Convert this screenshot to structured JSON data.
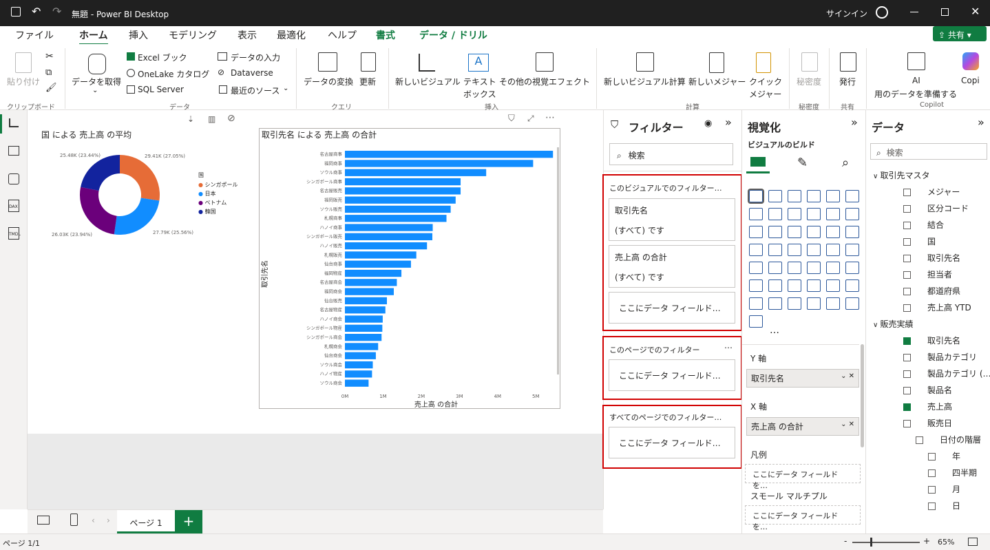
{
  "window": {
    "title": "無題 - Power BI Desktop",
    "signin": "サインイン"
  },
  "tabs": [
    "ファイル",
    "ホーム",
    "挿入",
    "モデリング",
    "表示",
    "最適化",
    "ヘルプ",
    "書式",
    "データ / ドリル"
  ],
  "share": "共有",
  "ribbon": {
    "clipboard": {
      "paste": "貼り付け",
      "group": "クリップボード"
    },
    "data": {
      "get": "データを取得",
      "excel": "Excel ブック",
      "onelake": "OneLake カタログ",
      "sql": "SQL Server",
      "enter": "データの入力",
      "dataverse": "Dataverse",
      "recent": "最近のソース",
      "group": "データ"
    },
    "query": {
      "transform": "データの変換",
      "refresh": "更新",
      "group": "クエリ"
    },
    "insert": {
      "newvisual": "新しいビジュアル",
      "textbox1": "テキスト",
      "textbox2": "ボックス",
      "more": "その他の視覚エフェクト",
      "group": "挿入"
    },
    "calc": {
      "newcalc": "新しいビジュアル計算",
      "newmeasure": "新しいメジャー",
      "quick1": "クイック",
      "quick2": "メジャー",
      "group": "計算"
    },
    "sens": {
      "label": "秘密度",
      "group": "秘密度"
    },
    "share": {
      "publish": "発行",
      "group": "共有"
    },
    "copilot": {
      "ai1": "AI",
      "ai2": "用のデータを準備する",
      "copi": "Copi",
      "group": "Copilot"
    }
  },
  "donut": {
    "title": "国 による 売上高 の平均",
    "legend_title": "国",
    "legend": [
      "シンガポール",
      "日本",
      "ベトナム",
      "韓国"
    ],
    "labels": [
      "29.41K (27.05%)",
      "27.79K (25.56%)",
      "26.03K (23.94%)",
      "25.48K (23.44%)"
    ]
  },
  "bar_title": "取引先名 による 売上高 の合計",
  "chart_data": {
    "type": "bar",
    "title": "取引先名 による 売上高 の合計",
    "xlabel": "売上高 の合計",
    "ylabel": "取引先名",
    "xlim": [
      0,
      5.5
    ],
    "xticks": [
      "0M",
      "1M",
      "2M",
      "3M",
      "4M",
      "5M"
    ],
    "categories": [
      "名古屋商事",
      "福岡商事",
      "ソウル商事",
      "シンガポール商事",
      "名古屋販売",
      "福岡販売",
      "ソウル販売",
      "札幌商事",
      "ハノイ商事",
      "シンガポール販売",
      "ハノイ販売",
      "札幌販売",
      "仙台商事",
      "福岡物産",
      "名古屋商会",
      "福岡商会",
      "仙台販売",
      "名古屋物産",
      "ハノイ商会",
      "シンガポール物産",
      "シンガポール商会",
      "札幌商会",
      "仙台商会",
      "ソウル商会",
      "ハノイ物産",
      "ソウル商会"
    ],
    "values": [
      5.45,
      4.93,
      3.7,
      3.03,
      3.03,
      2.9,
      2.77,
      2.66,
      2.3,
      2.29,
      2.15,
      1.87,
      1.73,
      1.48,
      1.36,
      1.28,
      1.1,
      1.06,
      0.99,
      0.98,
      0.96,
      0.87,
      0.81,
      0.73,
      0.71,
      0.62
    ],
    "color": "#118dff"
  },
  "filters": {
    "title": "フィルター",
    "search": "検索",
    "visual_title": "このビジュアルでのフィルター…",
    "page_title": "このページでのフィルター",
    "all_title": "すべてのページでのフィルター…",
    "card1_name": "取引先名",
    "card1_val": "(すべて) です",
    "card2_name": "売上高 の合計",
    "card2_val": "(すべて) です",
    "drop": "ここにデータ フィールド…"
  },
  "viz": {
    "title": "視覚化",
    "build": "ビジュアルのビルド",
    "yaxis": "Y 軸",
    "yfield": "取引先名",
    "xaxis": "X 軸",
    "xfield": "売上高 の合計",
    "legend": "凡例",
    "legend_drop": "ここにデータ フィールドを…",
    "small": "スモール マルチプル",
    "small_drop": "ここにデータ フィールドを…",
    "more": "…"
  },
  "data": {
    "title": "データ",
    "search": "検索",
    "tables": [
      {
        "name": "取引先マスタ",
        "fields": [
          "メジャー",
          "区分コード",
          "結合",
          "国",
          "取引先名",
          "担当者",
          "都道府県",
          "売上高 YTD"
        ]
      },
      {
        "name": "販売実績",
        "fields": [
          "取引先名",
          "製品カテゴリ",
          "製品カテゴリ (…",
          "製品名",
          "売上高",
          "販売日",
          "日付の階層",
          "年",
          "四半期",
          "月",
          "日"
        ]
      }
    ]
  },
  "pages": {
    "tab": "ページ 1"
  },
  "status": {
    "page": "ページ 1/1",
    "zoom": "65%"
  }
}
